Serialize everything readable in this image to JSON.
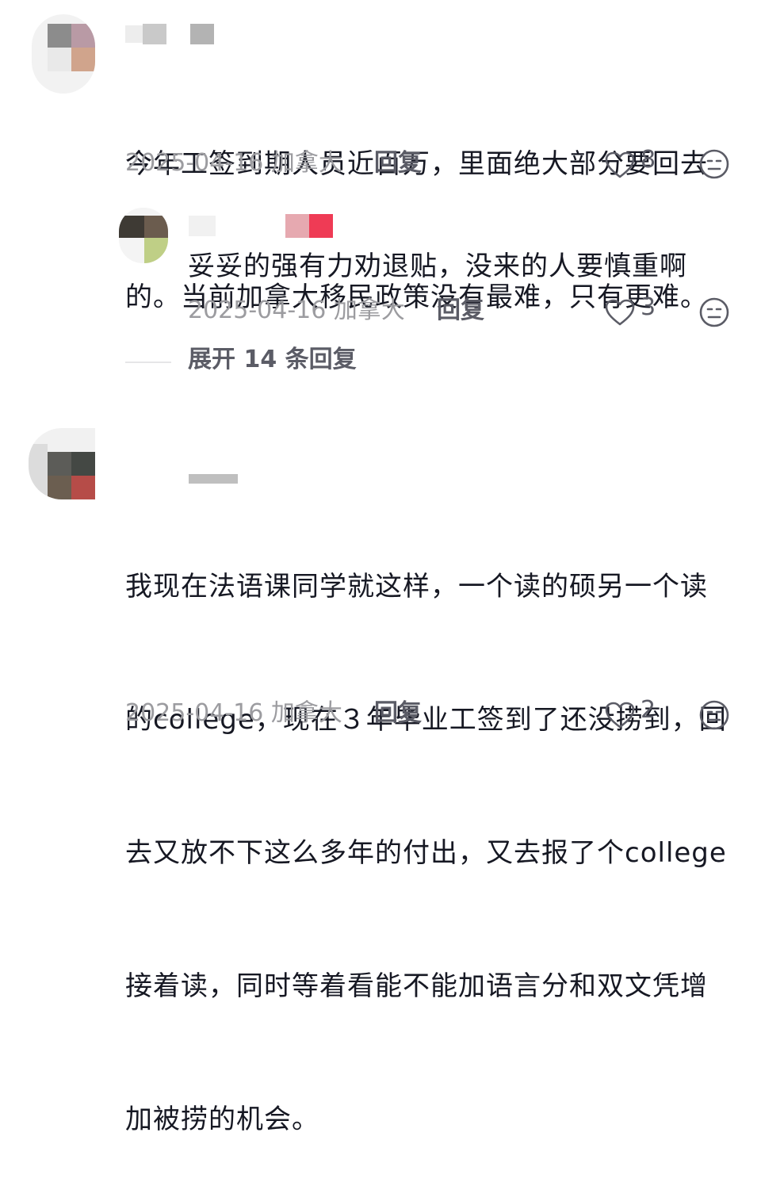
{
  "comments": [
    {
      "text_lines": [
        "今年工签到期人员近百万，里面绝大部分要回去",
        "的。当前加拿大移民政策没有最难，只有更难。"
      ],
      "date": "2025-04-16",
      "location": "加拿大",
      "reply_label": "回复",
      "likes": "8",
      "reply": {
        "text": "妥妥的强有力劝退贴，没来的人要慎重啊",
        "date": "2025-04-16",
        "location": "加拿大",
        "reply_label": "回复",
        "likes": "3"
      },
      "expand_label": "展开 14 条回复"
    },
    {
      "text_lines": [
        "我现在法语课同学就这样，一个读的硕另一个读",
        "的college，现在３年毕业工签到了还没捞到，回",
        "去又放不下这么多年的付出，又去报了个college",
        "接着读，同时等着看能不能加语言分和双文凭增",
        "加被捞的机会。"
      ],
      "date": "2025-04-16",
      "location": "加拿大",
      "reply_label": "回复",
      "likes": "2"
    }
  ],
  "icons": {
    "like": "heart-outline-icon",
    "dislike": "neutral-face-icon"
  },
  "colors": {
    "text": "#161823",
    "meta": "#9c9ca0",
    "secondary": "#5b5c66"
  }
}
